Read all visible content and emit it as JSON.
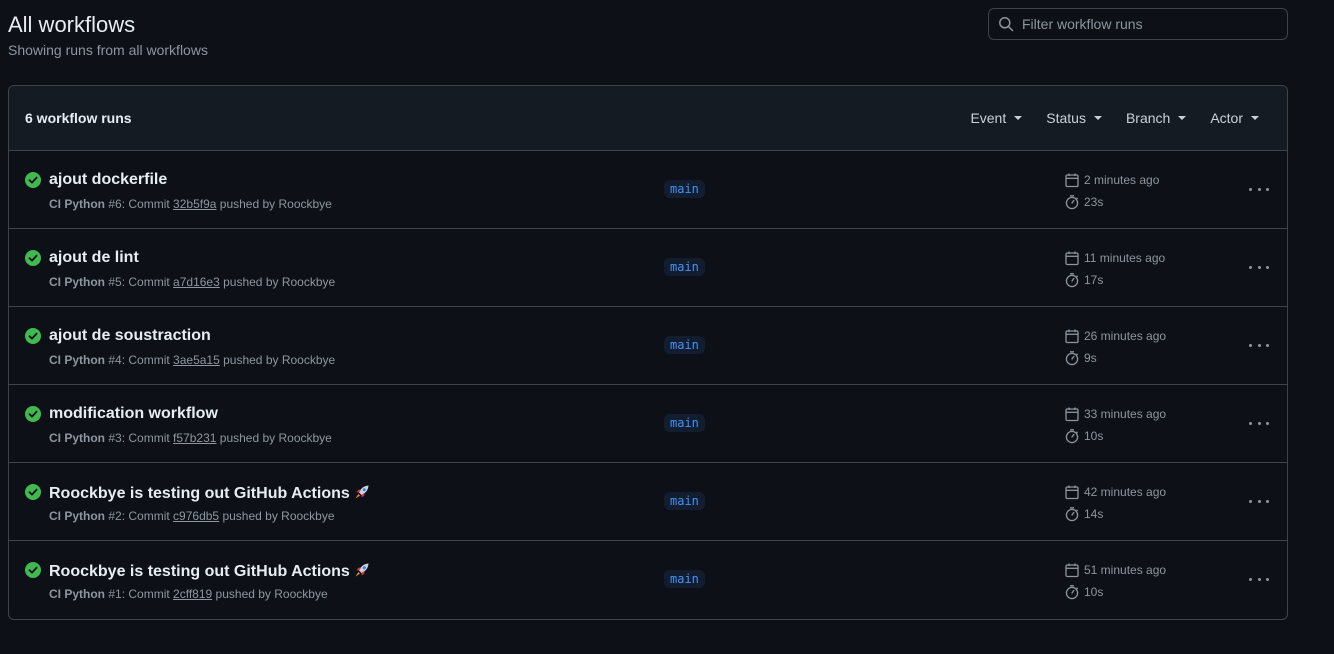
{
  "header": {
    "title": "All workflows",
    "subtitle": "Showing runs from all workflows"
  },
  "search": {
    "placeholder": "Filter workflow runs",
    "icon": "search-icon"
  },
  "runs_header": {
    "count_label": "6 workflow runs",
    "filters": [
      "Event",
      "Status",
      "Branch",
      "Actor"
    ]
  },
  "colors": {
    "background": "#0d1117",
    "success": "#3fb950",
    "branch_text": "#4493f8"
  },
  "runs": [
    {
      "title": "ajout dockerfile",
      "workflow": "CI Python",
      "number": "#6",
      "commit_label": ": Commit",
      "sha": "32b5f9a",
      "pushed_by": "pushed by Roockbye",
      "branch": "main",
      "time_ago": "2 minutes ago",
      "duration": "23s",
      "status": "success",
      "emoji": false
    },
    {
      "title": "ajout de lint",
      "workflow": "CI Python",
      "number": "#5",
      "commit_label": ": Commit",
      "sha": "a7d16e3",
      "pushed_by": "pushed by Roockbye",
      "branch": "main",
      "time_ago": "11 minutes ago",
      "duration": "17s",
      "status": "success",
      "emoji": false
    },
    {
      "title": "ajout de soustraction",
      "workflow": "CI Python",
      "number": "#4",
      "commit_label": ": Commit",
      "sha": "3ae5a15",
      "pushed_by": "pushed by Roockbye",
      "branch": "main",
      "time_ago": "26 minutes ago",
      "duration": "9s",
      "status": "success",
      "emoji": false
    },
    {
      "title": "modification workflow",
      "workflow": "CI Python",
      "number": "#3",
      "commit_label": ": Commit",
      "sha": "f57b231",
      "pushed_by": "pushed by Roockbye",
      "branch": "main",
      "time_ago": "33 minutes ago",
      "duration": "10s",
      "status": "success",
      "emoji": false
    },
    {
      "title": "Roockbye is testing out GitHub Actions",
      "workflow": "CI Python",
      "number": "#2",
      "commit_label": ": Commit",
      "sha": "c976db5",
      "pushed_by": "pushed by Roockbye",
      "branch": "main",
      "time_ago": "42 minutes ago",
      "duration": "14s",
      "status": "success",
      "emoji": true
    },
    {
      "title": "Roockbye is testing out GitHub Actions",
      "workflow": "CI Python",
      "number": "#1",
      "commit_label": ": Commit",
      "sha": "2cff819",
      "pushed_by": "pushed by Roockbye",
      "branch": "main",
      "time_ago": "51 minutes ago",
      "duration": "10s",
      "status": "success",
      "emoji": true
    }
  ]
}
